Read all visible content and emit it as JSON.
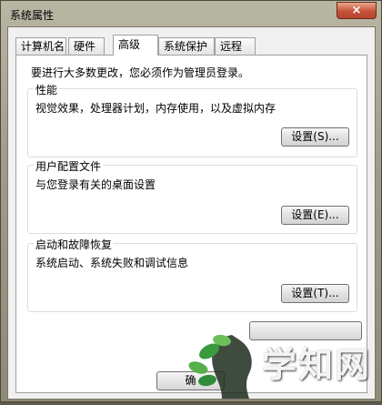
{
  "window": {
    "title": "系统属性",
    "close_label": "×"
  },
  "tabs": [
    {
      "label": "计算机名",
      "active": false
    },
    {
      "label": "硬件",
      "active": false
    },
    {
      "label": "高级",
      "active": true
    },
    {
      "label": "系统保护",
      "active": false
    },
    {
      "label": "远程",
      "active": false
    }
  ],
  "notice": "要进行大多数更改，您必须作为管理员登录。",
  "groups": [
    {
      "title": "性能",
      "description": "视觉效果，处理器计划，内存使用，以及虚拟内存",
      "button": "设置(S)..."
    },
    {
      "title": "用户配置文件",
      "description": "与您登录有关的桌面设置",
      "button": "设置(E)..."
    },
    {
      "title": "启动和故障恢复",
      "description": "系统启动、系统失败和调试信息",
      "button": "设置(T)..."
    }
  ],
  "bottom": {
    "ok_label": "确"
  },
  "watermark": {
    "text": "学知网"
  },
  "colors": {
    "watermark_leaf": "#2e8b3a",
    "window_frame": "#9f9c8a"
  }
}
